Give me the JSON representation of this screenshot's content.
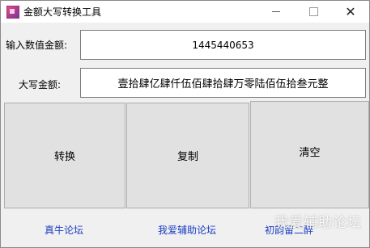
{
  "window": {
    "title": "金额大写转换工具",
    "controls": {
      "minimize": "—",
      "maximize": "□",
      "close": "✕"
    }
  },
  "form": {
    "input_label": "输入数值金额:",
    "input_value": "1445440653",
    "output_label": "大写金额:",
    "output_value": "壹拾肆亿肆仟伍佰肆拾肆万零陆佰伍拾叁元整"
  },
  "buttons": {
    "convert": "转换",
    "copy": "复制",
    "clear": "清空"
  },
  "links": {
    "link1": "真牛论坛",
    "link2": "我爱辅助论坛",
    "link3": "初韵留二醉"
  },
  "watermark": "我爱辅助论坛"
}
